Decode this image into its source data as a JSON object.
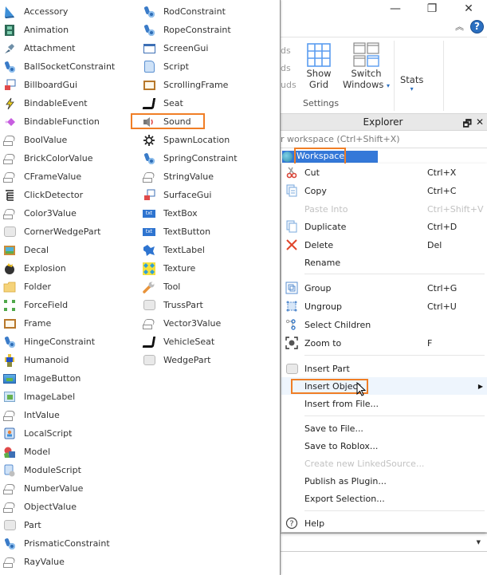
{
  "window_controls": {
    "minimize": "—",
    "restore": "❐",
    "close": "✕",
    "collapse_ribbon": "︽",
    "help": "?"
  },
  "ribbon": {
    "clipped_labels": [
      "ds",
      "ds",
      "uds"
    ],
    "show_grid": {
      "line1": "Show",
      "line2": "Grid"
    },
    "switch_windows": {
      "line1": "Switch",
      "line2": "Windows"
    },
    "stats": "Stats",
    "group_label": "Settings"
  },
  "explorer": {
    "title": "Explorer",
    "header_buttons": {
      "float": "🗗",
      "close": "✕"
    },
    "filter_placeholder": "r workspace (Ctrl+Shift+X)",
    "selected_item": "Workspace"
  },
  "context_menu": {
    "items": [
      {
        "label": "Cut",
        "shortcut": "Ctrl+X",
        "icon": "scissors-icon",
        "disabled": false
      },
      {
        "label": "Copy",
        "shortcut": "Ctrl+C",
        "icon": "copy-icon",
        "disabled": false
      },
      {
        "label": "Paste Into",
        "shortcut": "Ctrl+Shift+V",
        "icon": "",
        "disabled": true
      },
      {
        "label": "Duplicate",
        "shortcut": "Ctrl+D",
        "icon": "duplicate-icon",
        "disabled": false
      },
      {
        "label": "Delete",
        "shortcut": "Del",
        "icon": "delete-x-icon",
        "disabled": false
      },
      {
        "label": "Rename",
        "shortcut": "",
        "icon": "",
        "disabled": false
      },
      {
        "label": "Group",
        "shortcut": "Ctrl+G",
        "icon": "group-icon",
        "disabled": false
      },
      {
        "label": "Ungroup",
        "shortcut": "Ctrl+U",
        "icon": "ungroup-icon",
        "disabled": false
      },
      {
        "label": "Select Children",
        "shortcut": "",
        "icon": "select-children-icon",
        "disabled": false
      },
      {
        "label": "Zoom to",
        "shortcut": "F",
        "icon": "zoom-to-icon",
        "disabled": false
      },
      {
        "label": "Insert Part",
        "shortcut": "",
        "icon": "part-icon",
        "disabled": false
      },
      {
        "label": "Insert Object",
        "shortcut": "",
        "icon": "",
        "disabled": false,
        "submenu": true
      },
      {
        "label": "Insert from File...",
        "shortcut": "",
        "icon": "",
        "disabled": false
      },
      {
        "label": "Save to File...",
        "shortcut": "",
        "icon": "",
        "disabled": false
      },
      {
        "label": "Save to Roblox...",
        "shortcut": "",
        "icon": "",
        "disabled": false
      },
      {
        "label": "Create new LinkedSource...",
        "shortcut": "",
        "icon": "",
        "disabled": true
      },
      {
        "label": "Publish as Plugin...",
        "shortcut": "",
        "icon": "",
        "disabled": false
      },
      {
        "label": "Export Selection...",
        "shortcut": "",
        "icon": "",
        "disabled": false
      },
      {
        "label": "Help",
        "shortcut": "",
        "icon": "help-circle-icon",
        "disabled": false
      }
    ],
    "submenu_arrow": "▶"
  },
  "insert_object": {
    "column_a": [
      {
        "label": "Accessory",
        "icon": "accessory-icon"
      },
      {
        "label": "Animation",
        "icon": "animation-icon"
      },
      {
        "label": "Attachment",
        "icon": "attachment-icon"
      },
      {
        "label": "BallSocketConstraint",
        "icon": "constraint-icon"
      },
      {
        "label": "BillboardGui",
        "icon": "billboardgui-icon"
      },
      {
        "label": "BindableEvent",
        "icon": "bindableevent-icon"
      },
      {
        "label": "BindableFunction",
        "icon": "bindablefunction-icon"
      },
      {
        "label": "BoolValue",
        "icon": "value-icon"
      },
      {
        "label": "BrickColorValue",
        "icon": "value-icon"
      },
      {
        "label": "CFrameValue",
        "icon": "value-icon"
      },
      {
        "label": "ClickDetector",
        "icon": "clickdetector-icon"
      },
      {
        "label": "Color3Value",
        "icon": "value-icon"
      },
      {
        "label": "CornerWedgePart",
        "icon": "part-icon"
      },
      {
        "label": "Decal",
        "icon": "decal-icon"
      },
      {
        "label": "Explosion",
        "icon": "explosion-icon"
      },
      {
        "label": "Folder",
        "icon": "folder-icon"
      },
      {
        "label": "ForceField",
        "icon": "forcefield-icon"
      },
      {
        "label": "Frame",
        "icon": "frame-icon"
      },
      {
        "label": "HingeConstraint",
        "icon": "constraint-icon"
      },
      {
        "label": "Humanoid",
        "icon": "humanoid-icon"
      },
      {
        "label": "ImageButton",
        "icon": "imagebutton-icon"
      },
      {
        "label": "ImageLabel",
        "icon": "imagelabel-icon"
      },
      {
        "label": "IntValue",
        "icon": "value-icon"
      },
      {
        "label": "LocalScript",
        "icon": "localscript-icon"
      },
      {
        "label": "Model",
        "icon": "model-icon"
      },
      {
        "label": "ModuleScript",
        "icon": "modulescript-icon"
      },
      {
        "label": "NumberValue",
        "icon": "value-icon"
      },
      {
        "label": "ObjectValue",
        "icon": "value-icon"
      },
      {
        "label": "Part",
        "icon": "part-icon"
      },
      {
        "label": "PrismaticConstraint",
        "icon": "constraint-icon"
      },
      {
        "label": "RayValue",
        "icon": "value-icon"
      }
    ],
    "column_b": [
      {
        "label": "RodConstraint",
        "icon": "constraint-icon"
      },
      {
        "label": "RopeConstraint",
        "icon": "constraint-icon"
      },
      {
        "label": "ScreenGui",
        "icon": "screengui-icon"
      },
      {
        "label": "Script",
        "icon": "script-icon"
      },
      {
        "label": "ScrollingFrame",
        "icon": "frame-icon"
      },
      {
        "label": "Seat",
        "icon": "seat-icon"
      },
      {
        "label": "Sound",
        "icon": "sound-icon",
        "highlighted": true
      },
      {
        "label": "SpawnLocation",
        "icon": "spawnlocation-icon"
      },
      {
        "label": "SpringConstraint",
        "icon": "constraint-icon"
      },
      {
        "label": "StringValue",
        "icon": "value-icon"
      },
      {
        "label": "SurfaceGui",
        "icon": "surfacegui-icon"
      },
      {
        "label": "TextBox",
        "icon": "textbox-icon"
      },
      {
        "label": "TextButton",
        "icon": "textbutton-icon"
      },
      {
        "label": "TextLabel",
        "icon": "textlabel-icon"
      },
      {
        "label": "Texture",
        "icon": "texture-icon"
      },
      {
        "label": "Tool",
        "icon": "tool-icon"
      },
      {
        "label": "TrussPart",
        "icon": "part-icon"
      },
      {
        "label": "Vector3Value",
        "icon": "value-icon"
      },
      {
        "label": "VehicleSeat",
        "icon": "seat-icon"
      },
      {
        "label": "WedgePart",
        "icon": "part-icon"
      }
    ]
  },
  "annotation_color": "#f07e26"
}
